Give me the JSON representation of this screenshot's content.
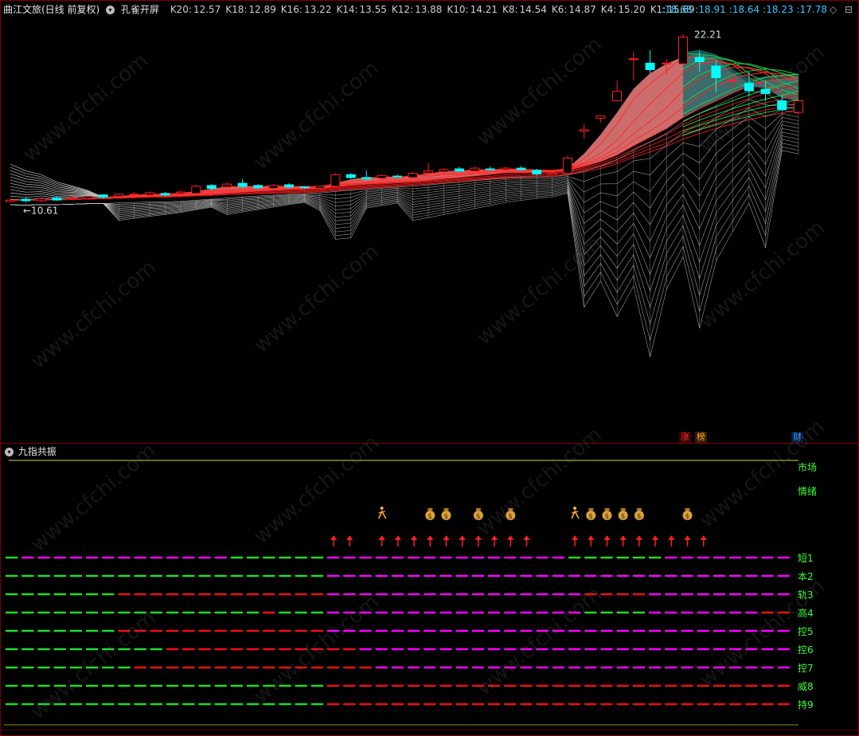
{
  "header": {
    "stock_title": "曲江文旅(日线 前复权)",
    "indicator_name": "孔雀开屏",
    "ma_values": [
      {
        "label": "K20:",
        "value": "12.57"
      },
      {
        "label": "K18:",
        "value": "12.89"
      },
      {
        "label": "K16:",
        "value": "13.22"
      },
      {
        "label": "K14:",
        "value": "13.55"
      },
      {
        "label": "K12:",
        "value": "13.88"
      },
      {
        "label": "K10:",
        "value": "14.21"
      },
      {
        "label": "K8:",
        "value": "14.54"
      },
      {
        "label": "K6:",
        "value": "14.87"
      },
      {
        "label": "K4:",
        "value": "15.20"
      },
      {
        "label": "K1:",
        "value": "15.69"
      }
    ],
    "right_values": [
      ":18.68",
      ":18.91",
      ":18.64",
      ":18.23",
      ":17.78"
    ],
    "right_icons": [
      "◇",
      "⊟"
    ]
  },
  "main_chart": {
    "high_label": "22.21",
    "low_label": "←10.61",
    "badges": [
      {
        "text": "涨",
        "color": "#ff3030"
      },
      {
        "text": "榜",
        "color": "#ff9933"
      },
      {
        "text": "财",
        "color": "#33a0ff"
      }
    ]
  },
  "sub_chart": {
    "title": "九指共振",
    "market_label": "市场",
    "mood_label": "情绪",
    "row_labels": [
      "短1",
      "本2",
      "轨3",
      "高4",
      "控5",
      "控6",
      "控7",
      "威8",
      "持9"
    ]
  },
  "watermark": "www.cfchi.com",
  "colors": {
    "bull": "#ff2020",
    "bear": "#00ffff",
    "green": "#22dd22",
    "magenta": "#ff00ff",
    "red": "#ee1111",
    "fan": "#cccccc",
    "pink_fill": "#f08080",
    "teal_fill": "#1a6a6a"
  },
  "chart_data": {
    "type": "candlestick",
    "title": "曲江文旅(日线 前复权)",
    "high": 22.21,
    "low": 10.61,
    "candles": [
      {
        "o": 10.65,
        "h": 10.85,
        "l": 10.61,
        "c": 10.75
      },
      {
        "o": 10.8,
        "h": 10.95,
        "l": 10.6,
        "c": 10.7
      },
      {
        "o": 10.7,
        "h": 10.9,
        "l": 10.6,
        "c": 10.85
      },
      {
        "o": 10.9,
        "h": 11.0,
        "l": 10.7,
        "c": 10.75
      },
      {
        "o": 10.85,
        "h": 11.0,
        "l": 10.75,
        "c": 10.9
      },
      {
        "o": 10.85,
        "h": 11.05,
        "l": 10.8,
        "c": 11.0
      },
      {
        "o": 11.1,
        "h": 11.15,
        "l": 10.85,
        "c": 10.95
      },
      {
        "o": 11.0,
        "h": 11.2,
        "l": 10.95,
        "c": 11.15
      },
      {
        "o": 11.1,
        "h": 11.3,
        "l": 11.0,
        "c": 11.15
      },
      {
        "o": 11.1,
        "h": 11.35,
        "l": 11.0,
        "c": 11.25
      },
      {
        "o": 11.2,
        "h": 11.3,
        "l": 11.0,
        "c": 11.1
      },
      {
        "o": 11.2,
        "h": 11.4,
        "l": 11.15,
        "c": 11.3
      },
      {
        "o": 11.2,
        "h": 11.8,
        "l": 11.1,
        "c": 11.7
      },
      {
        "o": 11.75,
        "h": 11.85,
        "l": 11.45,
        "c": 11.55
      },
      {
        "o": 11.65,
        "h": 11.95,
        "l": 11.55,
        "c": 11.85
      },
      {
        "o": 11.9,
        "h": 12.2,
        "l": 11.55,
        "c": 11.7
      },
      {
        "o": 11.75,
        "h": 11.85,
        "l": 11.5,
        "c": 11.6
      },
      {
        "o": 11.55,
        "h": 11.85,
        "l": 11.5,
        "c": 11.75
      },
      {
        "o": 11.8,
        "h": 11.9,
        "l": 11.55,
        "c": 11.65
      },
      {
        "o": 11.65,
        "h": 11.7,
        "l": 11.5,
        "c": 11.6
      },
      {
        "o": 11.55,
        "h": 11.75,
        "l": 11.45,
        "c": 11.7
      },
      {
        "o": 11.7,
        "h": 12.6,
        "l": 11.6,
        "c": 12.5
      },
      {
        "o": 12.5,
        "h": 12.6,
        "l": 12.2,
        "c": 12.3
      },
      {
        "o": 12.3,
        "h": 12.8,
        "l": 12.1,
        "c": 12.2
      },
      {
        "o": 12.25,
        "h": 12.5,
        "l": 12.1,
        "c": 12.45
      },
      {
        "o": 12.4,
        "h": 12.5,
        "l": 12.3,
        "c": 12.35
      },
      {
        "o": 12.3,
        "h": 12.7,
        "l": 12.2,
        "c": 12.6
      },
      {
        "o": 12.6,
        "h": 13.3,
        "l": 12.5,
        "c": 12.75
      },
      {
        "o": 12.7,
        "h": 12.95,
        "l": 12.55,
        "c": 12.85
      },
      {
        "o": 12.9,
        "h": 13.05,
        "l": 12.7,
        "c": 12.75
      },
      {
        "o": 12.75,
        "h": 13.05,
        "l": 12.7,
        "c": 12.95
      },
      {
        "o": 12.9,
        "h": 13.05,
        "l": 12.75,
        "c": 12.85
      },
      {
        "o": 12.85,
        "h": 13.05,
        "l": 12.75,
        "c": 12.95
      },
      {
        "o": 12.95,
        "h": 13.1,
        "l": 12.8,
        "c": 12.85
      },
      {
        "o": 12.8,
        "h": 12.9,
        "l": 12.45,
        "c": 12.55
      },
      {
        "o": 12.5,
        "h": 12.8,
        "l": 12.45,
        "c": 12.6
      },
      {
        "o": 12.6,
        "h": 13.8,
        "l": 12.55,
        "c": 13.65
      },
      {
        "o": 15.5,
        "h": 16.0,
        "l": 15.0,
        "c": 15.6
      },
      {
        "o": 16.4,
        "h": 16.5,
        "l": 16.1,
        "c": 16.55
      },
      {
        "o": 17.6,
        "h": 19.0,
        "l": 17.6,
        "c": 18.25
      },
      {
        "o": 20.5,
        "h": 21.0,
        "l": 19.0,
        "c": 20.5
      },
      {
        "o": 20.2,
        "h": 21.1,
        "l": 19.5,
        "c": 19.75
      },
      {
        "o": 20.15,
        "h": 20.5,
        "l": 19.4,
        "c": 20.2
      },
      {
        "o": 20.15,
        "h": 22.21,
        "l": 20.15,
        "c": 22.0
      },
      {
        "o": 20.6,
        "h": 21.0,
        "l": 19.6,
        "c": 20.3
      },
      {
        "o": 20.0,
        "h": 20.4,
        "l": 18.2,
        "c": 19.2
      },
      {
        "o": 19.0,
        "h": 19.5,
        "l": 18.4,
        "c": 19.0
      },
      {
        "o": 18.8,
        "h": 19.6,
        "l": 17.9,
        "c": 18.3
      },
      {
        "o": 18.4,
        "h": 19.0,
        "l": 17.6,
        "c": 18.1
      },
      {
        "o": 17.6,
        "h": 18.0,
        "l": 16.9,
        "c": 17.0
      },
      {
        "o": 16.8,
        "h": 17.6,
        "l": 16.7,
        "c": 17.6
      }
    ],
    "ma": {
      "K20": 12.57,
      "K18": 12.89,
      "K16": 13.22,
      "K14": 13.55,
      "K12": 13.88,
      "K10": 14.21,
      "K8": 14.54,
      "K6": 14.87,
      "K4": 15.2,
      "K1": 15.69
    }
  }
}
